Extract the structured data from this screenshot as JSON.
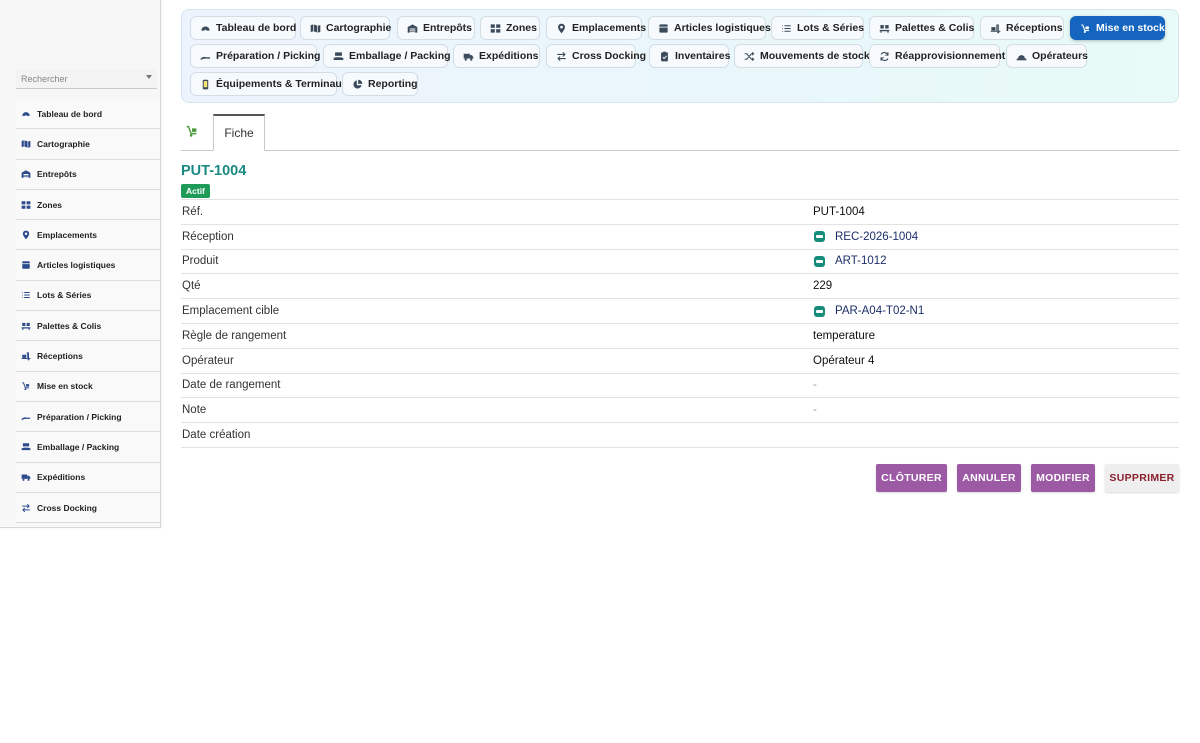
{
  "sidebar": {
    "search_placeholder": "Rechercher",
    "items": [
      {
        "label": "Tableau de bord",
        "icon": "dashboard-icon"
      },
      {
        "label": "Cartographie",
        "icon": "map-icon"
      },
      {
        "label": "Entrepôts",
        "icon": "warehouse-icon"
      },
      {
        "label": "Zones",
        "icon": "grid-icon"
      },
      {
        "label": "Emplacements",
        "icon": "location-pin-icon"
      },
      {
        "label": "Articles logistiques",
        "icon": "box-icon"
      },
      {
        "label": "Lots & Séries",
        "icon": "list-icon"
      },
      {
        "label": "Palettes & Colis",
        "icon": "pallet-icon"
      },
      {
        "label": "Réceptions",
        "icon": "truck-loading-icon"
      },
      {
        "label": "Mise en stock",
        "icon": "dolly-icon"
      },
      {
        "label": "Préparation / Picking",
        "icon": "hand-icon"
      },
      {
        "label": "Emballage / Packing",
        "icon": "packing-icon"
      },
      {
        "label": "Expéditions",
        "icon": "truck-icon"
      },
      {
        "label": "Cross Docking",
        "icon": "exchange-icon"
      }
    ]
  },
  "topnav": {
    "items": [
      {
        "label": "Tableau de bord",
        "icon": "dashboard-icon"
      },
      {
        "label": "Cartographie",
        "icon": "map-icon"
      },
      {
        "label": "Entrepôts",
        "icon": "warehouse-icon"
      },
      {
        "label": "Zones",
        "icon": "grid-icon"
      },
      {
        "label": "Emplacements",
        "icon": "location-pin-icon"
      },
      {
        "label": "Articles logistiques",
        "icon": "box-icon"
      },
      {
        "label": "Lots & Séries",
        "icon": "list-icon"
      },
      {
        "label": "Palettes & Colis",
        "icon": "pallet-icon"
      },
      {
        "label": "Réceptions",
        "icon": "truck-loading-icon"
      },
      {
        "label": "Mise en stock",
        "icon": "dolly-icon",
        "active": true
      },
      {
        "label": "Préparation / Picking",
        "icon": "hand-icon"
      },
      {
        "label": "Emballage / Packing",
        "icon": "packing-icon"
      },
      {
        "label": "Expéditions",
        "icon": "truck-icon"
      },
      {
        "label": "Cross Docking",
        "icon": "exchange-icon"
      },
      {
        "label": "Inventaires",
        "icon": "clipboard-icon"
      },
      {
        "label": "Mouvements de stock",
        "icon": "shuffle-icon"
      },
      {
        "label": "Réapprovisionnement",
        "icon": "refresh-icon"
      },
      {
        "label": "Opérateurs",
        "icon": "hard-hat-icon"
      },
      {
        "label": "Équipements & Terminaux",
        "icon": "mobile-icon"
      },
      {
        "label": "Reporting",
        "icon": "pie-chart-icon"
      }
    ]
  },
  "tabs": {
    "fiche_label": "Fiche"
  },
  "record": {
    "title": "PUT-1004",
    "status": "Actif",
    "fields": [
      {
        "label": "Réf.",
        "value": "PUT-1004",
        "kind": "text"
      },
      {
        "label": "Réception",
        "value": "REC-2026-1004",
        "kind": "link"
      },
      {
        "label": "Produit",
        "value": "ART-1012",
        "kind": "link"
      },
      {
        "label": "Qté",
        "value": "229",
        "kind": "text"
      },
      {
        "label": "Emplacement cible",
        "value": "PAR-A04-T02-N1",
        "kind": "link"
      },
      {
        "label": "Règle de rangement",
        "value": "temperature",
        "kind": "text"
      },
      {
        "label": "Opérateur",
        "value": "Opérateur 4",
        "kind": "text"
      },
      {
        "label": "Date de rangement",
        "value": "-",
        "kind": "muted"
      },
      {
        "label": "Note",
        "value": "-",
        "kind": "muted"
      },
      {
        "label": "Date création",
        "value": "",
        "kind": "text"
      }
    ]
  },
  "actions": {
    "close_label": "CLÔTURER",
    "cancel_label": "ANNULER",
    "edit_label": "MODIFIER",
    "delete_label": "SUPPRIMER"
  },
  "colors": {
    "accent": "#1565c0",
    "title": "#1a8a83",
    "status": "#1e9b57",
    "action": "#9c5aa4",
    "delete_text": "#8a1f2e"
  }
}
